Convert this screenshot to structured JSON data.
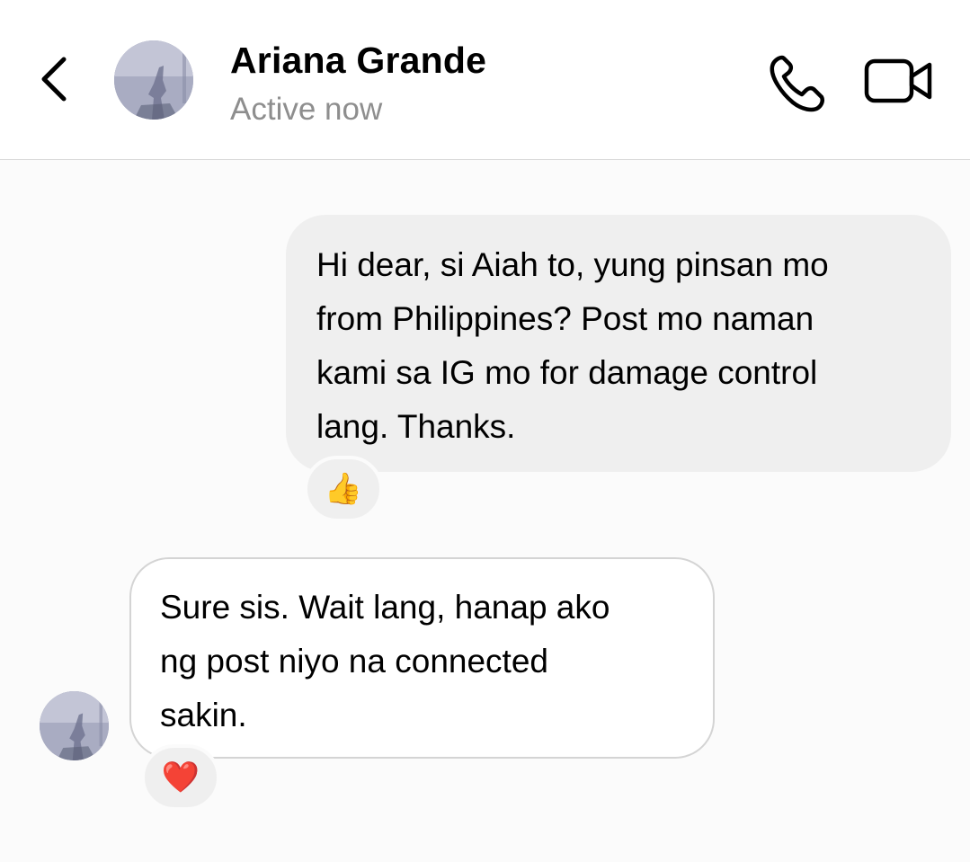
{
  "header": {
    "contact_name": "Ariana Grande",
    "status": "Active now",
    "back_icon": "chevron-left-icon",
    "call_icon": "phone-icon",
    "video_icon": "video-camera-icon"
  },
  "messages": [
    {
      "direction": "outgoing",
      "lines": [
        "Hi dear, si Aiah to, yung pinsan mo",
        "from Philippines? Post mo naman",
        "kami sa IG mo for damage control",
        "lang. Thanks."
      ],
      "reaction": "👍"
    },
    {
      "direction": "incoming",
      "lines": [
        "Sure sis. Wait lang, hanap ako",
        "ng post niyo na connected",
        "sakin."
      ],
      "reaction": "❤️"
    }
  ],
  "colors": {
    "outgoing_bubble": "#efefef",
    "incoming_bubble": "#ffffff",
    "status_text": "#8e8e8e",
    "background": "#fbfbfb"
  }
}
